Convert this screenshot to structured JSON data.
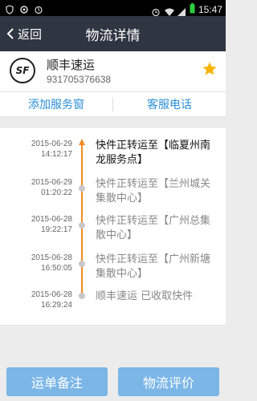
{
  "status_bar": {
    "time": "15:47",
    "icons": [
      "shield-icon",
      "settings-icon",
      "alarm-icon",
      "alarm-clock-icon",
      "wifi-icon",
      "signal-icon",
      "battery-icon"
    ]
  },
  "header": {
    "back_label": "返回",
    "title": "物流详情"
  },
  "carrier": {
    "logo_text": "SF",
    "name": "顺丰速运",
    "tracking_number": "931705376638",
    "favorite_color": "#f5b400"
  },
  "actions": {
    "add_window": "添加服务窗",
    "service_phone": "客服电话"
  },
  "timeline": [
    {
      "date": "2015-06-29",
      "time": "14:12:17",
      "text": "快件正转运至【临夏州南龙服务点】"
    },
    {
      "date": "2015-06-29",
      "time": "01:20:22",
      "text": "快件正转运至【兰州城关集散中心】"
    },
    {
      "date": "2015-06-28",
      "time": "19:22:17",
      "text": "快件正转运至【广州总集散中心】"
    },
    {
      "date": "2015-06-28",
      "time": "16:50:05",
      "text": "快件正转运至【广州新塘集散中心】"
    },
    {
      "date": "2015-06-28",
      "time": "16:29:24",
      "text": "顺丰速运 已收取快件"
    }
  ],
  "bottom": {
    "note": "运单备注",
    "review": "物流评价"
  },
  "colors": {
    "nav_bg": "#2f3541",
    "accent_link": "#2b8fd6",
    "timeline_active": "#f08a24",
    "bottom_button": "#7bb6e6"
  }
}
